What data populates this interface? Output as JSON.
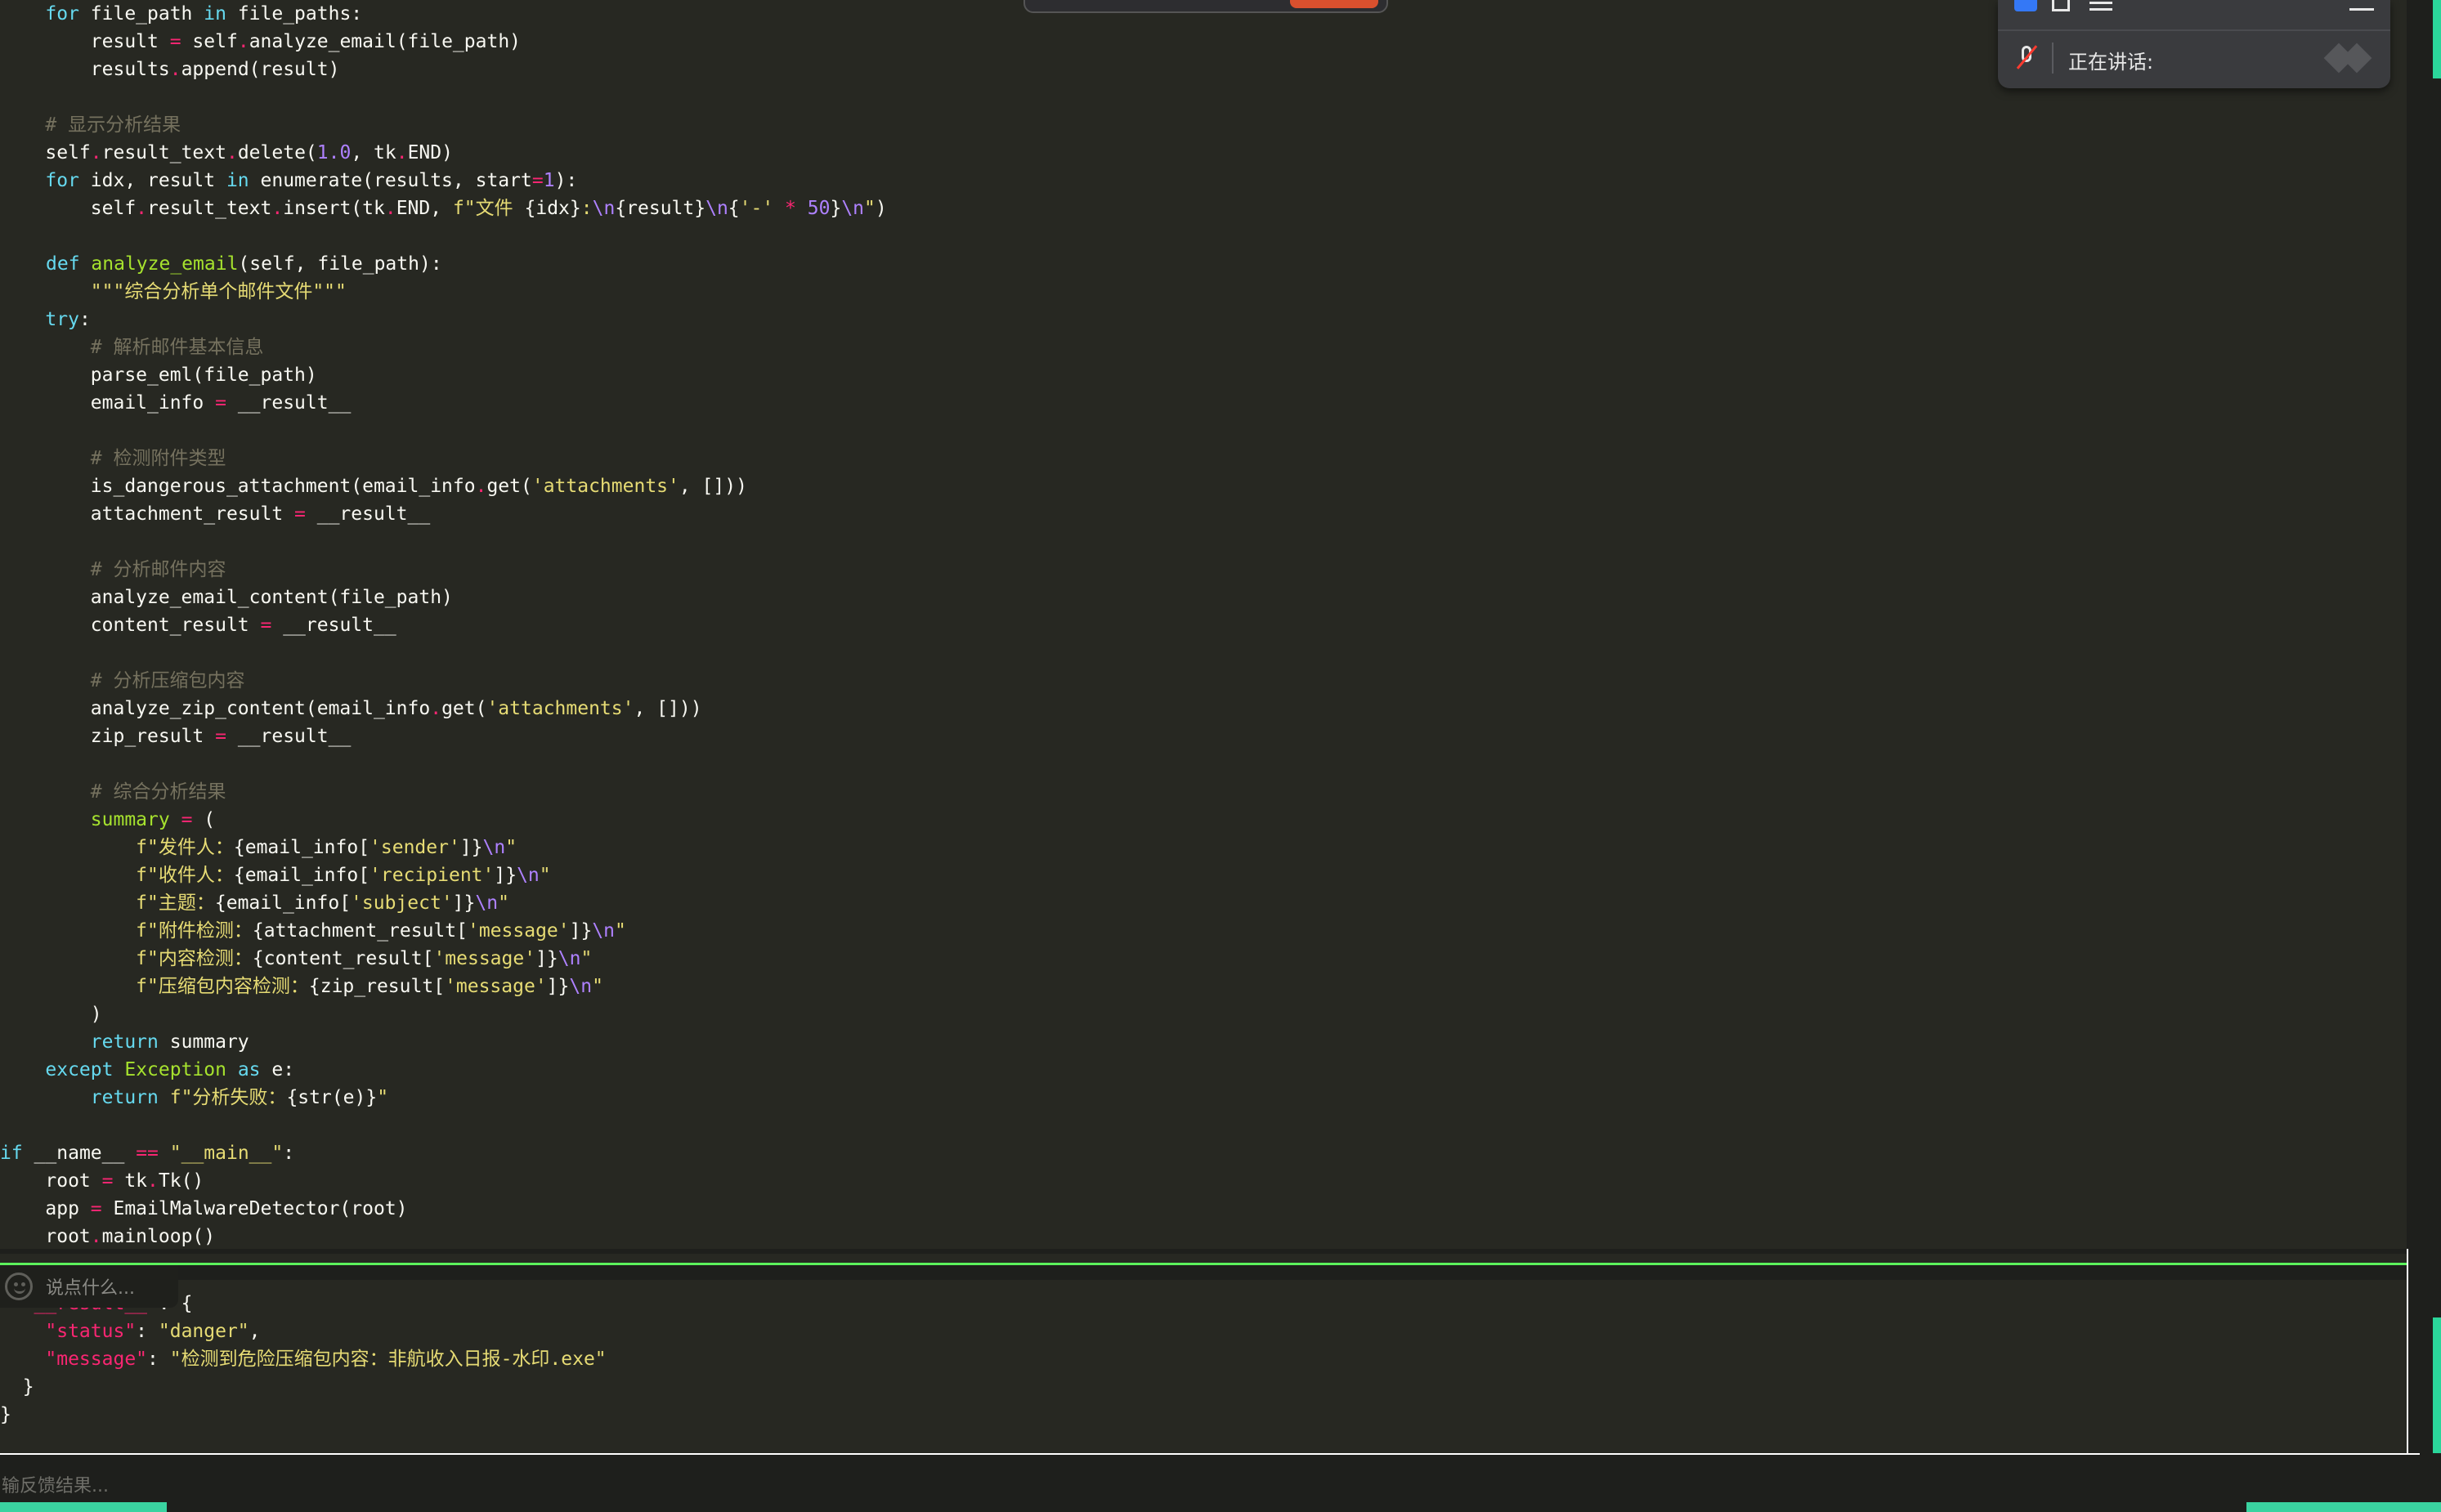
{
  "editor": {
    "code": {
      "l1": {
        "a": "    ",
        "for": "for",
        "b": " file_path ",
        "in": "in",
        "c": " file_paths:"
      },
      "l2": {
        "a": "        result ",
        "eq": "=",
        "b": " self",
        "dot": ".",
        "c": "analyze_email(file_path)"
      },
      "l3": {
        "a": "        results",
        "dot": ".",
        "c": "append(result)"
      },
      "l5": "    # 显示分析结果",
      "l6": {
        "a": "    self",
        "d1": ".",
        "b": "result_text",
        "d2": ".",
        "c": "delete(",
        "n": "1.0",
        "e": ", tk",
        "d3": ".",
        "f": "END)"
      },
      "l7": {
        "a": "    ",
        "for": "for",
        "b": " idx, result ",
        "in": "in",
        "c": " enumerate(results, start",
        "eq": "=",
        "n": "1",
        "d": "):"
      },
      "l8": {
        "a": "        self",
        "d1": ".",
        "b": "result_text",
        "d2": ".",
        "c": "insert(tk",
        "d3": ".",
        "e": "END, ",
        "s1": "f\"文件 ",
        "b1": "{idx}",
        "s2": ":",
        "esc1": "\\n",
        "b2": "{result}",
        "esc2": "\\n",
        "b3": "{",
        "s3": "'-'",
        "op": " * ",
        "n": "50",
        "b4": "}",
        "esc3": "\\n",
        "s4": "\"",
        "f": ")"
      },
      "l10": {
        "a": "def",
        "b": " ",
        "fn": "analyze_email",
        "c": "(self, file_path):"
      },
      "l11": "        \"\"\"综合分析单个邮件文件\"\"\"",
      "l12": {
        "a": "    ",
        "kw": "try",
        "b": ":"
      },
      "l13": "        # 解析邮件基本信息",
      "l14": "        parse_eml(file_path)",
      "l15": {
        "a": "        email_info ",
        "eq": "=",
        "b": " __result__"
      },
      "l17": "        # 检测附件类型",
      "l18": {
        "a": "        is_dangerous_attachment(email_info",
        "dot": ".",
        "b": "get(",
        "s": "'attachments'",
        "c": ", []))"
      },
      "l19": {
        "a": "        attachment_result ",
        "eq": "=",
        "b": " __result__"
      },
      "l21": "        # 分析邮件内容",
      "l22": "        analyze_email_content(file_path)",
      "l23": {
        "a": "        content_result ",
        "eq": "=",
        "b": " __result__"
      },
      "l25": "        # 分析压缩包内容",
      "l26": {
        "a": "        analyze_zip_content(email_info",
        "dot": ".",
        "b": "get(",
        "s": "'attachments'",
        "c": ", []))"
      },
      "l27": {
        "a": "        zip_result ",
        "eq": "=",
        "b": " __result__"
      },
      "l29": "        # 综合分析结果",
      "l30": {
        "a": "        summary ",
        "eq": "=",
        "b": " ("
      },
      "l31": {
        "a": "            ",
        "s1": "f\"发件人：",
        "b1": "{email_info[",
        "s2": "'sender'",
        "b2": "]}",
        "esc": "\\n",
        "s3": "\""
      },
      "l32": {
        "a": "            ",
        "s1": "f\"收件人：",
        "b1": "{email_info[",
        "s2": "'recipient'",
        "b2": "]}",
        "esc": "\\n",
        "s3": "\""
      },
      "l33": {
        "a": "            ",
        "s1": "f\"主题：",
        "b1": "{email_info[",
        "s2": "'subject'",
        "b2": "]}",
        "esc": "\\n",
        "s3": "\""
      },
      "l34": {
        "a": "            ",
        "s1": "f\"附件检测：",
        "b1": "{attachment_result[",
        "s2": "'message'",
        "b2": "]}",
        "esc": "\\n",
        "s3": "\""
      },
      "l35": {
        "a": "            ",
        "s1": "f\"内容检测：",
        "b1": "{content_result[",
        "s2": "'message'",
        "b2": "]}",
        "esc": "\\n",
        "s3": "\""
      },
      "l36": {
        "a": "            ",
        "s1": "f\"压缩包内容检测：",
        "b1": "{zip_result[",
        "s2": "'message'",
        "b2": "]}",
        "esc": "\\n",
        "s3": "\""
      },
      "l37": "        )",
      "l38": {
        "a": "        ",
        "kw": "return",
        "b": " summary"
      },
      "l39": {
        "a": "    ",
        "kw": "except",
        "b": " ",
        "cls": "Exception",
        "c": " ",
        "kw2": "as",
        "d": " e:"
      },
      "l40": {
        "a": "        ",
        "kw": "return",
        "b": " ",
        "s1": "f\"分析失败：",
        "b1": "{str(e)}",
        "s2": "\""
      },
      "l42": {
        "kw": "if",
        "a": " __name__ ",
        "eq": "==",
        "b": " ",
        "s": "\"__main__\"",
        "c": ":"
      },
      "l43": {
        "a": "    root ",
        "eq": "=",
        "b": " tk",
        "dot": ".",
        "c": "Tk()"
      },
      "l44": {
        "a": "    app ",
        "eq": "=",
        "b": " EmailMalwareDetector(root)"
      },
      "l45": {
        "a": "    root",
        "dot": ".",
        "c": "mainloop()"
      }
    }
  },
  "chat_input": {
    "placeholder": "说点什么..."
  },
  "result": {
    "line1": {
      "a": "  ",
      "k": "\"__result__\"",
      "b": ": {"
    },
    "line2": {
      "a": "    ",
      "k": "\"status\"",
      "b": ": ",
      "v": "\"danger\"",
      "c": ","
    },
    "line3": {
      "a": "    ",
      "k": "\"message\"",
      "b": ": ",
      "v": "\"检测到危险压缩包内容：非航收入日报-水印.exe\""
    },
    "line4": "  }",
    "line5": "}"
  },
  "feedback": {
    "placeholder": "输反馈结果..."
  },
  "meeting": {
    "status": "正在讲话:"
  },
  "colors": {
    "background": "#272822",
    "keyword": "#66d9ef",
    "string": "#e6db74",
    "number": "#ae81ff",
    "operator": "#f92672",
    "function": "#a6e22e",
    "comment": "#75715e",
    "accent_green": "#5cf25c",
    "record_button": "#d9502e"
  }
}
